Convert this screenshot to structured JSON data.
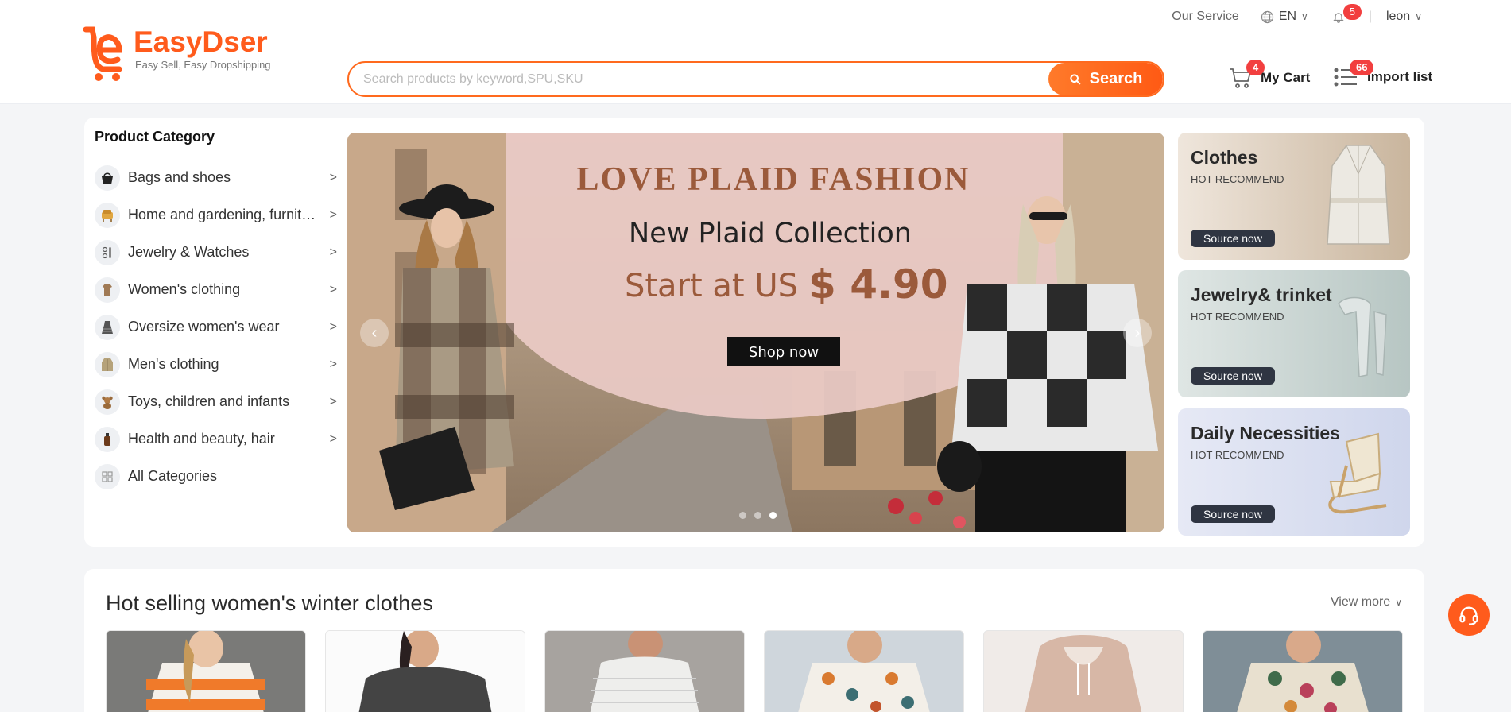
{
  "topbar": {
    "service": "Our Service",
    "language": "EN",
    "notifications": "5",
    "user": "leon"
  },
  "logo": {
    "name": "EasyDser",
    "tagline": "Easy Sell,  Easy Dropshipping"
  },
  "search": {
    "placeholder": "Search products by keyword,SPU,SKU",
    "button": "Search"
  },
  "cart": {
    "label": "My Cart",
    "count": "4"
  },
  "import_list": {
    "label": "Import list",
    "count": "66"
  },
  "categories": {
    "title": "Product Category",
    "items": [
      {
        "label": "Bags and shoes",
        "icon": "handbag-icon"
      },
      {
        "label": "Home and gardening, furnitu...",
        "icon": "armchair-icon"
      },
      {
        "label": "Jewelry & Watches",
        "icon": "jewelry-icon"
      },
      {
        "label": "Women's clothing",
        "icon": "coat-icon"
      },
      {
        "label": "Oversize women's wear",
        "icon": "dress-icon"
      },
      {
        "label": "Men's clothing",
        "icon": "jacket-icon"
      },
      {
        "label": "Toys, children and infants",
        "icon": "teddy-bear-icon"
      },
      {
        "label": "Health and beauty, hair",
        "icon": "bottle-icon"
      }
    ],
    "all": "All Categories"
  },
  "banner": {
    "headline": "LOVE PLAID FASHION",
    "subhead": "New Plaid Collection",
    "price_prefix": "Start at US",
    "price": "$ 4.90",
    "cta": "Shop now",
    "active_slide": 3,
    "slide_count": 3
  },
  "side_cards": [
    {
      "title": "Clothes",
      "subtitle": "HOT RECOMMEND",
      "button": "Source now"
    },
    {
      "title": "Jewelry& trinket",
      "subtitle": "HOT RECOMMEND",
      "button": "Source now"
    },
    {
      "title": "Daily Necessities",
      "subtitle": "HOT RECOMMEND",
      "button": "Source now"
    }
  ],
  "hot_selling": {
    "title": "Hot selling women's winter clothes",
    "view_more": "View more"
  },
  "colors": {
    "brand": "#ff5b1c",
    "badge": "#f23f3f",
    "button_dark": "#2f3542"
  }
}
